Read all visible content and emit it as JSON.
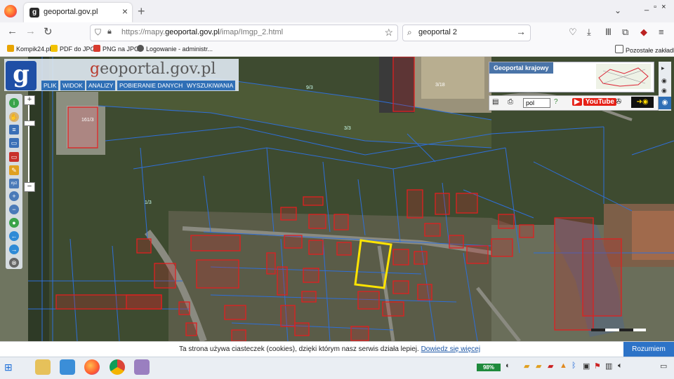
{
  "browser": {
    "tab_title": "geoportal.gov.pl",
    "tab_favicon": "g",
    "new_tab": "+",
    "close": "×",
    "url_prefix": "https://mapy.",
    "url_domain": "geoportal.gov.pl",
    "url_suffix": "/imap/Imgp_2.html",
    "search_value": "geoportal 2",
    "window_controls": "_ ▫ ×"
  },
  "bookmarks": [
    {
      "label": "Kompik24.pl",
      "color": "#e8a400"
    },
    {
      "label": "PDF do JPG",
      "color": "#f2c200"
    },
    {
      "label": "PNG na JPG",
      "color": "#d83b2f"
    },
    {
      "label": "Logowanie - administr...",
      "color": "#555555"
    }
  ],
  "bookmarks_other": "Pozostałe zakładki",
  "geoportal": {
    "logo_letter": "g",
    "brand_prefix": "g",
    "brand_rest": "eoportal.gov.pl",
    "menu": [
      "PLIK",
      "WIDOK",
      "ANALIZY",
      "POBIERANIE DANYCH",
      "WYSZUKIWANIA"
    ],
    "krajowy_label": "Geoportal krajowy",
    "lang": "pol",
    "youtube": "YouTube",
    "map_labels": [
      "161/3",
      "3/18",
      "3/3",
      "1/3",
      "9/3"
    ]
  },
  "cookie": {
    "text": "Ta strona używa ciasteczek (cookies), dzięki którym nasz serwis działa lepiej.",
    "link": "Dowiedz się więcej",
    "accept": "Rozumiem"
  },
  "taskbar": {
    "battery": "98%"
  },
  "colors": {
    "accent_blue": "#2f6fb6",
    "parcel_outline": "#2f6fd8",
    "building_red": "#e02020",
    "selection_yellow": "#ffe400"
  }
}
